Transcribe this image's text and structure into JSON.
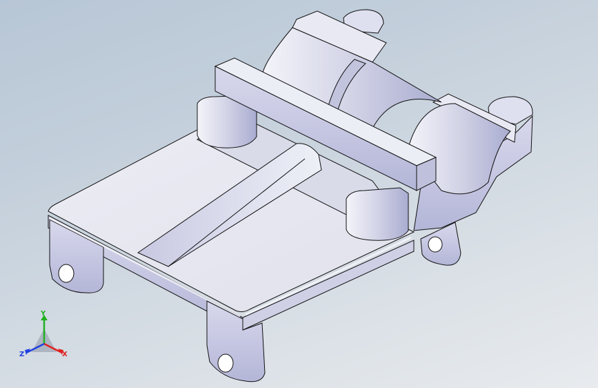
{
  "viewport": {
    "background_top": "#b7c6d6",
    "background_bottom": "#e8ebee",
    "part_face_color": "#e6e7f0",
    "part_side_color": "#c9c9e0",
    "part_shadow_color": "#8f94b8",
    "edge_color": "#101010"
  },
  "triad": {
    "x_label": "X",
    "y_label": "Y",
    "z_label": "Z",
    "x_color": "#e02020",
    "y_color": "#20b020",
    "z_color": "#2040e0"
  }
}
